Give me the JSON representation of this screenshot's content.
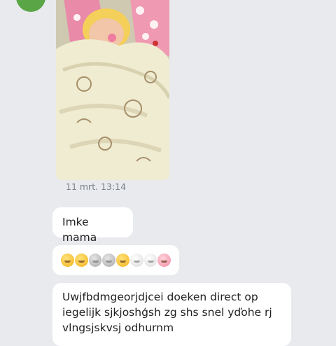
{
  "message_photo": {
    "time": "11 mrt. 13:14"
  },
  "messages": [
    {
      "text": "Imke mama"
    },
    {
      "emojis": [
        "grinning-squint-face-icon",
        "smirking-face-icon",
        "rat-icon",
        "hedgehog-icon",
        "kissing-face-icon",
        "rabbit-face-icon",
        "dog-face-icon",
        "pig-nose-icon"
      ]
    },
    {
      "text": "Uwjfbdmgeorjdjcei doeken direct op iegelijk sjkjoshģsh zg shs snel yďohe rj vlngsjskvsj odhurnm"
    }
  ],
  "colors": {
    "background": "#e8eaed",
    "bubble": "#ffffff",
    "avatar": "#5aa646",
    "timestamp": "#7a7f86"
  }
}
